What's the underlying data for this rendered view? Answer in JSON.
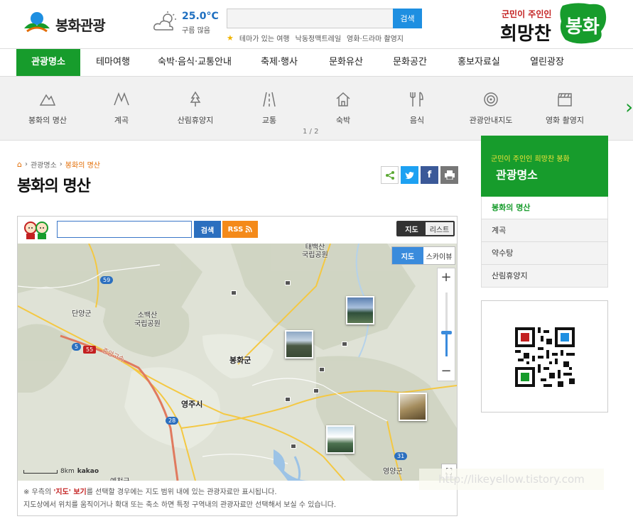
{
  "header": {
    "logo_text": "봉화관광",
    "weather": {
      "temp": "25.0°C",
      "desc": "구름 많음",
      "icon": "partly-cloudy-icon"
    },
    "search": {
      "placeholder": "",
      "button_label": "검색"
    },
    "hashtags": [
      "테마가 있는 여행",
      "낙동정맥트레일",
      "영화·드라마 촬영지"
    ],
    "slogan": "군민이 주인인 희망찬 봉화"
  },
  "gnb": {
    "items": [
      "관광명소",
      "테마여행",
      "숙박·음식·교통안내",
      "축제·행사",
      "문화유산",
      "문화공간",
      "홍보자료실",
      "열린광장"
    ],
    "active_index": 0
  },
  "subbar": {
    "items": [
      {
        "label": "봉화의 명산",
        "icon": "mountain-icon"
      },
      {
        "label": "계곡",
        "icon": "valley-icon"
      },
      {
        "label": "산림휴양지",
        "icon": "tree-icon"
      },
      {
        "label": "교통",
        "icon": "road-icon"
      },
      {
        "label": "숙박",
        "icon": "house-icon"
      },
      {
        "label": "음식",
        "icon": "utensils-icon"
      },
      {
        "label": "관광안내지도",
        "icon": "target-icon"
      },
      {
        "label": "영화 촬영지",
        "icon": "clapperboard-icon"
      }
    ],
    "page": "1 / 2",
    "next": "›"
  },
  "breadcrumb": {
    "parent": "관광명소",
    "current": "봉화의 명산",
    "sep": "›"
  },
  "page_title": "봉화의 명산",
  "share": {
    "facebook": "f"
  },
  "map": {
    "search_button": "검색",
    "rss_label": "RSS",
    "view_toggle": {
      "map": "지도",
      "list": "리스트"
    },
    "map_type": {
      "map": "지도",
      "skyview": "스카이뷰"
    },
    "zoom": {
      "plus": "+",
      "minus": "−"
    },
    "scale": {
      "distance": "8km",
      "brand": "kakao"
    },
    "fullscreen": "⛶",
    "labels": {
      "taebaek": "태백산\n국립공원",
      "danyang": "단양군",
      "sobaek": "소백산\n국립공원",
      "bonghwa": "봉화군",
      "yeongju": "영주시",
      "yeongyang": "영양군",
      "yecheon": "예천군",
      "expressway": "중앙고속"
    },
    "road_numbers": [
      "59",
      "5",
      "55",
      "28",
      "31"
    ],
    "notes": {
      "line1_prefix": "※ 우측의 ",
      "line1_highlight": "'지도' 보기",
      "line1_suffix": "를 선택할 경우에는 지도 범위 내에 있는 관광자료만 표시됩니다.",
      "line2": "지도상에서 위치를 움직이거나 확대 또는 축소 하면 특정 구역내의 관광자료만 선택해서 보실 수 있습니다."
    }
  },
  "watermark": "http://likeyellow.tistory.com",
  "sidebar": {
    "banner_sub": "군민이 주인인 희망찬 봉화",
    "banner_title": "관광명소",
    "menu": [
      "봉화의 명산",
      "계곡",
      "약수탕",
      "산림휴양지"
    ],
    "active_index": 0
  },
  "colors": {
    "brand_green": "#179c2c",
    "accent_blue": "#1e8fe1",
    "accent_orange": "#e36b00"
  }
}
